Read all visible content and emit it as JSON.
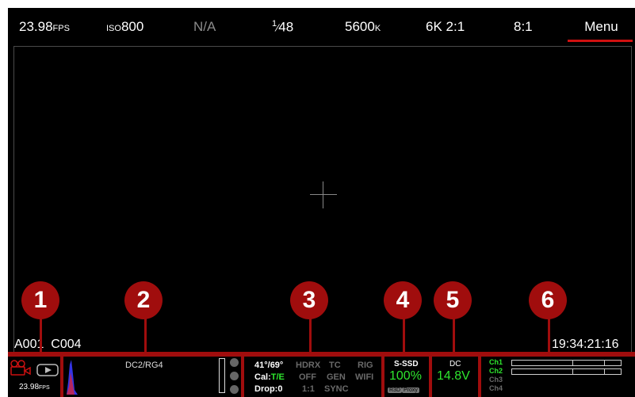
{
  "top_bar": {
    "fps_value": "23.98",
    "fps_unit": "FPS",
    "iso_prefix": "ISO",
    "iso_value": "800",
    "aperture": "N/A",
    "shutter_num": "1",
    "shutter_den": "48",
    "wb_value": "5600",
    "wb_unit": "K",
    "resolution": "6K 2:1",
    "compression": "8:1",
    "menu_label": "Menu"
  },
  "viewport": {
    "clip_id": "A001  C004",
    "timecode": "19:34:21:16"
  },
  "bottom_bar": {
    "record_fps": "23.98",
    "record_fps_unit": "FPS",
    "look": "DC2/RG4",
    "temps": "41°/69°",
    "cal_label": "Cal:",
    "cal_value": "T/E",
    "drop": "Drop:0",
    "hdrx_label": "HDRX",
    "hdrx_value": "OFF",
    "hdrx_ratio": "1:1",
    "tc_label": "TC",
    "tc_gen": "GEN",
    "tc_sync": "SYNC",
    "rig_label": "RIG",
    "wifi_label": "WIFI",
    "media_label": "S-SSD",
    "media_percent": "100%",
    "media_badge_1": "R3D",
    "media_badge_2": "Proxy",
    "power_label": "DC",
    "power_voltage": "14.8V",
    "audio_channels": [
      "Ch1",
      "Ch2",
      "Ch3",
      "Ch4"
    ]
  },
  "markers": [
    "1",
    "2",
    "3",
    "4",
    "5",
    "6"
  ],
  "colors": {
    "accent_red": "#a00d0d",
    "menu_underline": "#d01010",
    "status_green": "#2ee62e"
  }
}
